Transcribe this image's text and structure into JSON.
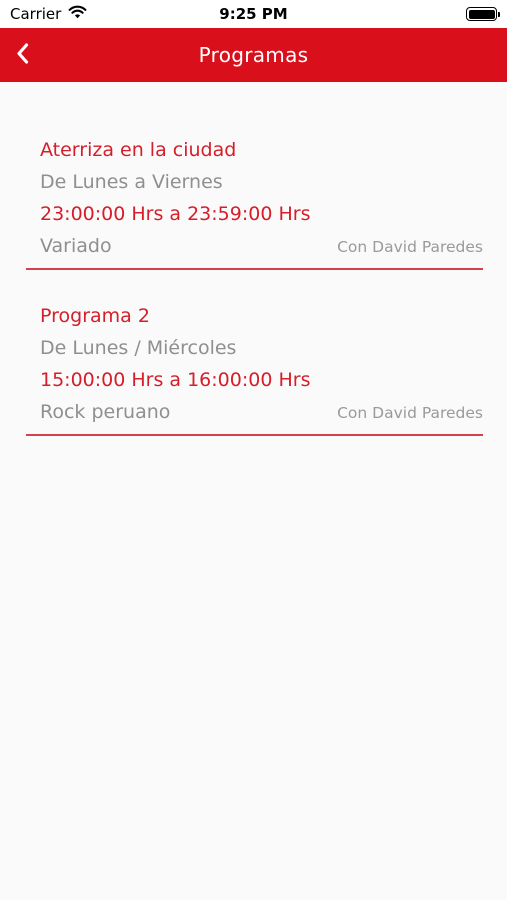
{
  "status_bar": {
    "carrier": "Carrier",
    "time": "9:25 PM",
    "icons": [
      "wifi-icon",
      "battery-icon"
    ]
  },
  "nav": {
    "title": "Programas",
    "back_icon": "chevron-left-icon",
    "background_color": "#d90f1c"
  },
  "colors": {
    "accent": "#d51e2a",
    "secondary_text": "#8f8f8f",
    "background": "#fafafa"
  },
  "programs": [
    {
      "name": "Aterriza en la ciudad",
      "days": "De Lunes a Viernes",
      "hours": "23:00:00 Hrs a 23:59:00 Hrs",
      "genre": "Variado",
      "host": "Con David Paredes"
    },
    {
      "name": "Programa 2",
      "days": "De Lunes / Miércoles",
      "hours": "15:00:00 Hrs a 16:00:00 Hrs",
      "genre": "Rock peruano",
      "host": "Con David Paredes"
    }
  ]
}
